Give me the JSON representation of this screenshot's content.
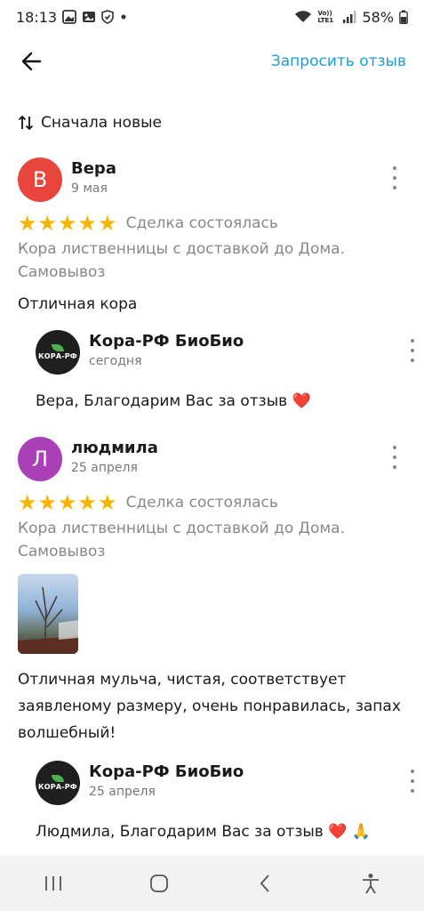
{
  "status_bar": {
    "time": "18:13",
    "battery": "58%",
    "network": "Vo)) LTE1",
    "icons": [
      "gallery-icon",
      "photo-icon",
      "shield-icon",
      "dot-icon",
      "wifi-icon",
      "signal-icon",
      "battery-icon"
    ]
  },
  "toolbar": {
    "back_icon": "arrow-left-icon",
    "request_review_label": "Запросить отзыв",
    "accent_color": "#1a9fd9"
  },
  "sort": {
    "icon": "sort-arrows-icon",
    "label": "Сначала новые"
  },
  "reviews": [
    {
      "avatar_letter": "В",
      "avatar_color": "#e8453c",
      "author": "Вера",
      "date": "9 мая",
      "rating": 5,
      "deal_status": "Сделка состоялась",
      "product_line1": "Кора лиственницы с доставкой до Дома.",
      "product_line2": "Самовывоз",
      "text": "Отличная кора",
      "reply": {
        "shop_name": "Кора-РФ БиоБио",
        "logo_text": "КОРА-РФ",
        "date": "сегодня",
        "text": "Вера, Благодарим Вас за отзыв ❤️"
      }
    },
    {
      "avatar_letter": "Л",
      "avatar_color": "#a940b8",
      "author": "людмила",
      "date": "25 апреля",
      "rating": 5,
      "deal_status": "Сделка состоялась",
      "product_line1": "Кора лиственницы с доставкой до Дома.",
      "product_line2": "Самовывоз",
      "text_line1": "Отличная мульча, чистая, соответствует",
      "text_line2": "заявленому размеру, очень понравилась, запах",
      "text_line3": "волшебный!",
      "reply": {
        "shop_name": "Кора-РФ БиоБио",
        "logo_text": "КОРА-РФ",
        "date": "25 апреля",
        "text": "Людмила, Благодарим Вас за отзыв ❤️ 🙏"
      }
    }
  ],
  "star_color": "#f5b400",
  "nav_bar": {
    "icons": [
      "recent-apps-icon",
      "home-icon",
      "back-icon",
      "accessibility-icon"
    ]
  }
}
